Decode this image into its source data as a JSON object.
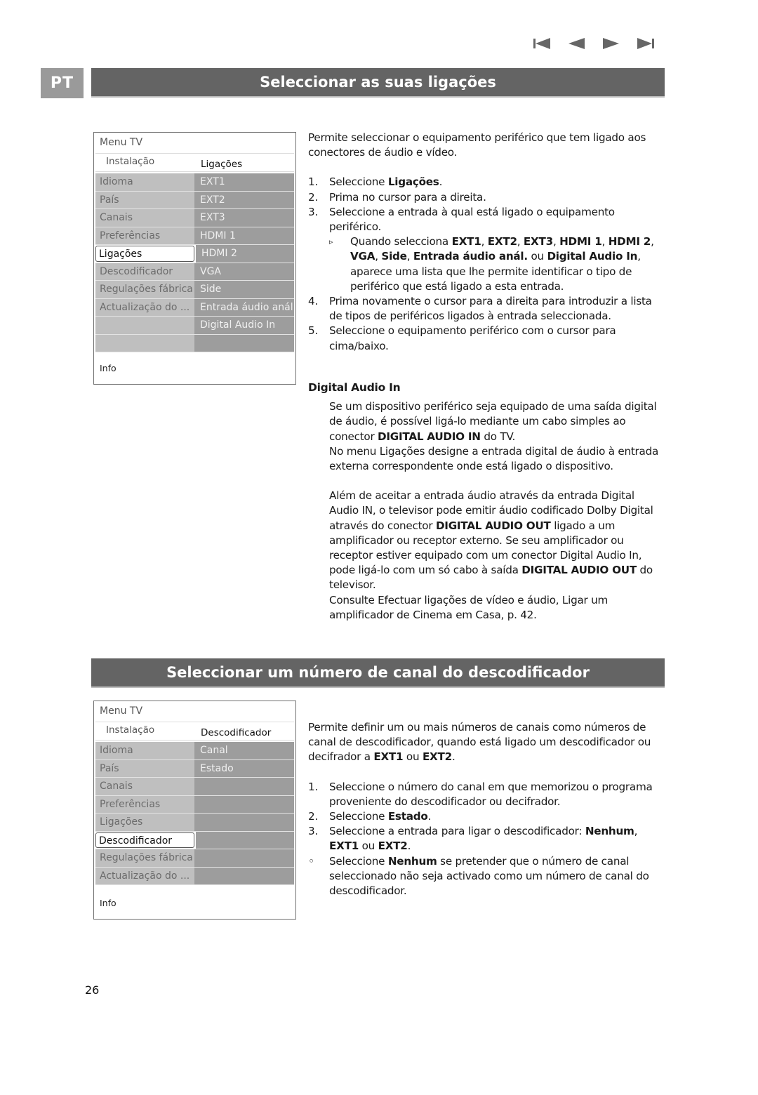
{
  "navigation": {
    "first_icon": "skip-to-first-icon",
    "prev_icon": "previous-icon",
    "next_icon": "next-icon",
    "last_icon": "skip-to-last-icon"
  },
  "language_tag": "PT",
  "colors": {
    "section_bar": "#646464",
    "language_tag": "#9a9a9a",
    "menu_left_column": "#bfbfbf",
    "menu_right_column": "#9d9d9d"
  },
  "section1": {
    "title": "Seleccionar as suas ligações",
    "menu": {
      "title": "Menu TV",
      "sub_left": "Instalação",
      "sub_right": "Ligações",
      "left_items": [
        "Idioma",
        "País",
        "Canais",
        "Preferências",
        "Ligações",
        "Descodificador",
        "Regulações fábrica",
        "Actualização do ...",
        "",
        ""
      ],
      "selected_index": 4,
      "right_items": [
        "EXT1",
        "EXT2",
        "EXT3",
        "HDMI 1",
        "HDMI 2",
        "VGA",
        "Side",
        "Entrada áudio anál.",
        "Digital Audio In",
        ""
      ],
      "info": "Info"
    },
    "intro": "Permite seleccionar o equipamento periférico que tem ligado aos conectores de áudio e vídeo.",
    "steps": [
      {
        "num": "1.",
        "pre": "Seleccione ",
        "bold": "Ligações",
        "post": "."
      },
      {
        "num": "2.",
        "pre": "Prima no cursor para a direita.",
        "bold": "",
        "post": ""
      },
      {
        "num": "3.",
        "pre": "Seleccione a entrada à qual está ligado o equipamento periférico.",
        "bold": "",
        "post": ""
      }
    ],
    "sub_bullet": {
      "marker": "▹",
      "t1": "Quando selecciona ",
      "b1": "EXT1",
      "t2": ", ",
      "b2": "EXT2",
      "t3": ", ",
      "b3": "EXT3",
      "t4": ", ",
      "b4": "HDMI 1",
      "t5": ", ",
      "b5": "HDMI 2",
      "t6": ", ",
      "b6": "VGA",
      "t7": ", ",
      "b7": "Side",
      "t8": ", ",
      "b8": "Entrada áudio anál.",
      "t9": " ou ",
      "b9": "Digital Audio In",
      "t10": ", aparece uma lista que lhe permite identificar o tipo de periférico que está ligado a esta entrada."
    },
    "steps_after": [
      {
        "num": "4.",
        "text": "Prima novamente o cursor para a direita para introduzir a lista de tipos de periféricos ligados à entrada seleccionada."
      },
      {
        "num": "5.",
        "text": "Seleccione o equipamento periférico com o cursor para cima/baixo."
      }
    ],
    "digital_audio": {
      "heading": "Digital Audio In",
      "p1_a": "Se um dispositivo periférico seja equipado de uma saída digital de áudio, é possível ligá-lo mediante um cabo simples ao conector ",
      "p1_b": "DIGITAL AUDIO IN",
      "p1_c": " do TV.",
      "p2": "No menu Ligações designe a entrada digital de áudio à entrada externa correspondente onde está ligado o dispositivo.",
      "p3_a": "Além de aceitar a entrada áudio através da entrada Digital Audio IN, o televisor pode emitir áudio codificado Dolby Digital através do conector ",
      "p3_b": "DIGITAL AUDIO OUT",
      "p3_c": " ligado a um amplificador ou receptor externo. Se seu amplificador ou receptor estiver equipado com um conector Digital Audio In, pode ligá-lo com um só cabo à saída ",
      "p3_d": "DIGITAL AUDIO OUT",
      "p3_e": " do televisor.",
      "p4": "Consulte Efectuar ligações de vídeo e áudio, Ligar um amplificador de Cinema em Casa, p. 42."
    }
  },
  "section2": {
    "title": "Seleccionar um número de canal do descodificador",
    "menu": {
      "title": "Menu TV",
      "sub_left": "Instalação",
      "sub_right": "Descodificador",
      "left_items": [
        "Idioma",
        "País",
        "Canais",
        "Preferências",
        "Ligações",
        "Descodificador",
        "Regulações fábrica",
        "Actualização do ..."
      ],
      "selected_index": 5,
      "right_items": [
        "Canal",
        "Estado",
        "",
        "",
        "",
        "",
        "",
        ""
      ],
      "info": "Info"
    },
    "intro_a": "Permite definir um ou mais números de canais como números de canal de descodificador, quando está ligado um descodificador ou decifrador a ",
    "intro_b": "EXT1",
    "intro_c": " ou ",
    "intro_d": "EXT2",
    "intro_e": ".",
    "step1": {
      "num": "1.",
      "text": "Seleccione o número do canal em que memorizou o programa proveniente do descodificador ou decifrador."
    },
    "step2": {
      "num": "2.",
      "pre": "Seleccione ",
      "bold": "Estado",
      "post": "."
    },
    "step3": {
      "num": "3.",
      "pre": "Seleccione a entrada para ligar o descodificador: ",
      "b1": "Nenhum",
      "t1": ", ",
      "b2": "EXT1",
      "t2": " ou ",
      "b3": "EXT2",
      "t3": "."
    },
    "note": {
      "marker": "◦",
      "pre": "Seleccione ",
      "bold": "Nenhum",
      "post": " se pretender que o número de canal seleccionado não seja activado como um número de canal do descodificador."
    }
  },
  "page_number": "26"
}
